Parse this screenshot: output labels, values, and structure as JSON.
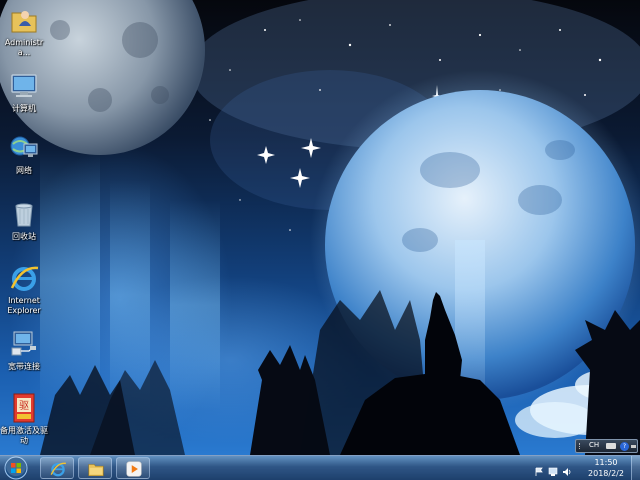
{
  "desktop": {
    "icons": [
      {
        "name": "administrator-folder",
        "icon": "user-folder-icon",
        "label": "Administra..."
      },
      {
        "name": "computer",
        "icon": "computer-icon",
        "label": "计算机"
      },
      {
        "name": "network",
        "icon": "network-icon",
        "label": "网络"
      },
      {
        "name": "recycle-bin",
        "icon": "recycle-bin-icon",
        "label": "回收站"
      },
      {
        "name": "internet-explorer",
        "icon": "internet-explorer-icon",
        "label": "Internet\nExplorer"
      },
      {
        "name": "broadband-connection",
        "icon": "broadband-connection-icon",
        "label": "宽带连接"
      },
      {
        "name": "backup-activation-driver",
        "icon": "activation-tool-icon",
        "label": "备用激活及驱\n动"
      }
    ]
  },
  "taskbar": {
    "start_icon": "windows-start-orb-icon",
    "pinned": [
      {
        "name": "internet-explorer",
        "icon": "internet-explorer-icon"
      },
      {
        "name": "file-explorer",
        "icon": "folder-icon"
      },
      {
        "name": "media-player",
        "icon": "media-player-icon"
      }
    ],
    "tray_icons": [
      "action-center-flag-icon",
      "network-status-icon",
      "volume-icon"
    ],
    "clock": {
      "time": "11:50",
      "date": "2018/2/2"
    }
  },
  "language_bar": {
    "language": "CH",
    "keyboard_icon": "keyboard-icon",
    "help_label": "?",
    "help_icon": "help-icon"
  },
  "colors": {
    "wallpaper_sky": "#0b1a33",
    "wallpaper_glow": "#2a7ad0",
    "taskbar": "#28507f"
  }
}
